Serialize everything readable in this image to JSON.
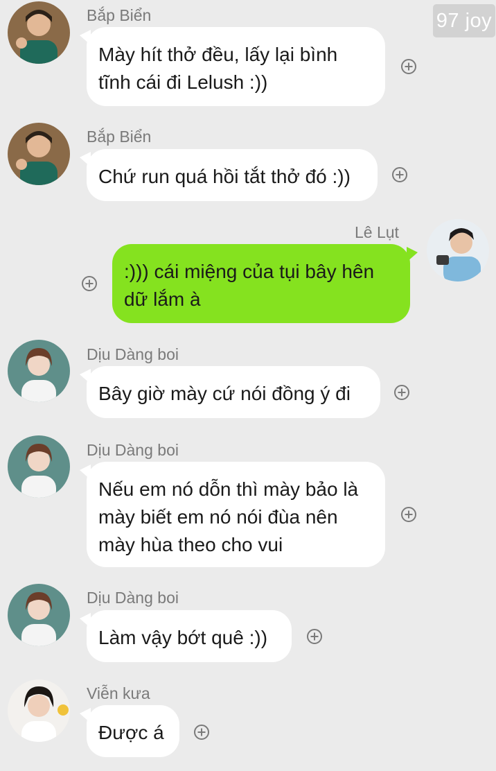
{
  "watermark": "97 joy",
  "colors": {
    "background": "#ebebeb",
    "incoming_bubble": "#ffffff",
    "outgoing_bubble": "#85e21f",
    "sender_name": "#7a7a7a"
  },
  "messages": [
    {
      "sender": "Bắp Biển",
      "direction": "incoming",
      "avatar": "avatar-bap-bien",
      "lines": [
        "Mày hít thở đều, lấy lại bình",
        "tĩnh cái đi Lelush :))"
      ]
    },
    {
      "sender": "Bắp Biển",
      "direction": "incoming",
      "avatar": "avatar-bap-bien",
      "lines": [
        "Chứ run quá hồi tắt thở đó :))"
      ]
    },
    {
      "sender": "Lê Lụt",
      "direction": "outgoing",
      "avatar": "avatar-le-lut",
      "lines": [
        ":))) cái miệng của tụi bây hên",
        "dữ lắm à"
      ]
    },
    {
      "sender": "Dịu Dàng boi",
      "direction": "incoming",
      "avatar": "avatar-diu-dang-boi",
      "lines": [
        "Bây giờ mày cứ nói đồng ý đi"
      ]
    },
    {
      "sender": "Dịu Dàng boi",
      "direction": "incoming",
      "avatar": "avatar-diu-dang-boi",
      "lines": [
        "Nếu em nó dỗn thì mày bảo là",
        "mày biết em nó nói đùa nên",
        "mày hùa theo cho vui"
      ]
    },
    {
      "sender": "Dịu Dàng boi",
      "direction": "incoming",
      "avatar": "avatar-diu-dang-boi",
      "lines": [
        "Làm vậy bớt quê :))"
      ]
    },
    {
      "sender": "Viễn kưa",
      "direction": "incoming",
      "avatar": "avatar-vien-kua",
      "lines": [
        "Được á"
      ]
    }
  ],
  "react_icon": "add-circle-icon"
}
